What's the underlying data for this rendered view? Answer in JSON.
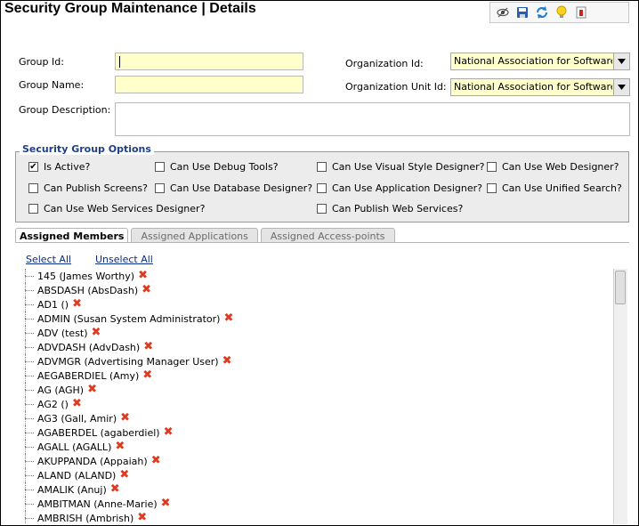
{
  "header": {
    "title": "Security Group Maintenance  |  Details"
  },
  "toolbar": {
    "icons": [
      "eye-icon",
      "save-icon",
      "refresh-icon",
      "lightbulb-icon",
      "delete-icon"
    ]
  },
  "form": {
    "group_id_label": "Group Id:",
    "group_id_value": "",
    "group_name_label": "Group Name:",
    "group_name_value": "",
    "group_description_label": "Group Description:",
    "group_description_value": "",
    "organization_id_label": "Organization Id:",
    "organization_id_value": "National Association for Software E",
    "organization_unit_id_label": "Organization Unit Id:",
    "organization_unit_id_value": "National Association for Software E"
  },
  "options": {
    "legend": "Security Group Options",
    "items": [
      {
        "label": "Is Active?",
        "checked": true
      },
      {
        "label": "Can Use Debug Tools?",
        "checked": false
      },
      {
        "label": "Can Use Visual Style Designer?",
        "checked": false
      },
      {
        "label": "Can Use Web Designer?",
        "checked": false
      },
      {
        "label": "Can Publish Screens?",
        "checked": false
      },
      {
        "label": "Can Use Database Designer?",
        "checked": false
      },
      {
        "label": "Can Use Application Designer?",
        "checked": false
      },
      {
        "label": "Can Use Unified Search?",
        "checked": false
      },
      {
        "label": "Can Use Web Services Designer?",
        "checked": false
      },
      {
        "label": "Can Publish Web Services?",
        "checked": false
      }
    ]
  },
  "tabs": [
    {
      "label": "Assigned Members",
      "active": true
    },
    {
      "label": "Assigned Applications",
      "active": false
    },
    {
      "label": "Assigned Access-points",
      "active": false
    }
  ],
  "members": {
    "select_all": "Select All",
    "unselect_all": "Unselect All",
    "items": [
      "145 (James Worthy)",
      "ABSDASH (AbsDash)",
      "AD1 ()",
      "ADMIN (Susan System Administrator)",
      "ADV (test)",
      "ADVDASH (AdvDash)",
      "ADVMGR (Advertising Manager User)",
      "AEGABERDIEL (Amy)",
      "AG (AGH)",
      "AG2 ()",
      "AG3 (Gall, Amir)",
      "AGABERDEL (agaberdiel)",
      "AGALL (AGALL)",
      "AKUPPANDA (Appaiah)",
      "ALAND (ALAND)",
      "AMALIK (Anuj)",
      "AMBITMAN (Anne-Marie)",
      "AMBRISH (Ambrish)"
    ]
  }
}
